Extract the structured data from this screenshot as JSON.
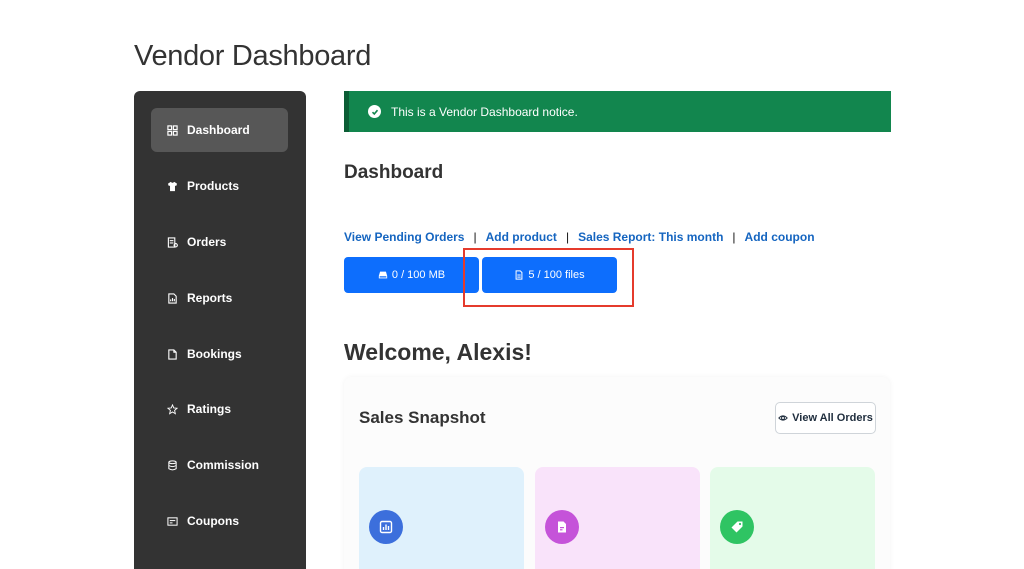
{
  "page": {
    "title": "Vendor Dashboard"
  },
  "sidebar": {
    "items": [
      {
        "label": "Dashboard",
        "icon": "grid-icon",
        "active": true
      },
      {
        "label": "Products",
        "icon": "tshirt-icon"
      },
      {
        "label": "Orders",
        "icon": "receipt-icon"
      },
      {
        "label": "Reports",
        "icon": "report-icon"
      },
      {
        "label": "Bookings",
        "icon": "calendar-icon"
      },
      {
        "label": "Ratings",
        "icon": "star-icon"
      },
      {
        "label": "Commission",
        "icon": "coins-icon"
      },
      {
        "label": "Coupons",
        "icon": "ticket-icon"
      }
    ]
  },
  "notice": {
    "text": "This is a Vendor Dashboard notice.",
    "color": "#12864e"
  },
  "dashboard": {
    "title": "Dashboard",
    "links": [
      "View Pending Orders",
      "Add product",
      "Sales Report: This month",
      "Add coupon"
    ],
    "separator": "|",
    "quota": {
      "storage": "0 / 100 MB",
      "files": "5 / 100 files"
    },
    "accent": "#0d6efd",
    "highlight_color": "#e53b2c"
  },
  "welcome": {
    "text": "Welcome, Alexis!"
  },
  "snapshot": {
    "title": "Sales Snapshot",
    "view_all": "View All Orders",
    "cards": [
      {
        "icon": "bar-chart-icon",
        "bg": "#dff1fc",
        "accent": "#3c6fdc"
      },
      {
        "icon": "document-icon",
        "bg": "#f9e3fa",
        "accent": "#c553d9"
      },
      {
        "icon": "tag-icon",
        "bg": "#e4fbe9",
        "accent": "#2fc463"
      }
    ]
  }
}
